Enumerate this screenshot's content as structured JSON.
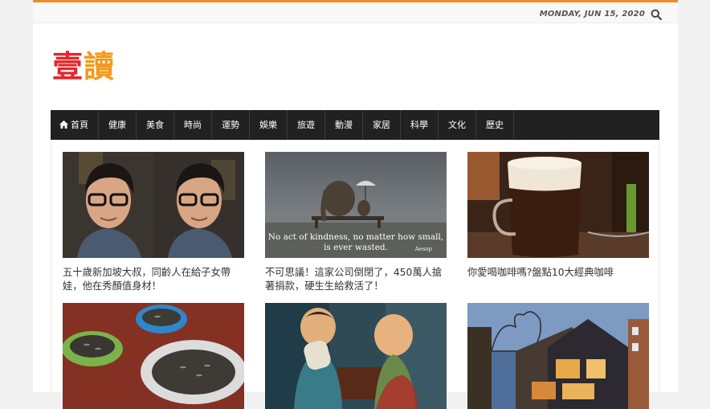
{
  "header": {
    "date": "MONDAY, JUN 15, 2020",
    "logo_char_1": "壹",
    "logo_char_2": "讀"
  },
  "nav": {
    "items": [
      "首頁",
      "健康",
      "美食",
      "時尚",
      "運勢",
      "娛樂",
      "旅遊",
      "動漫",
      "家居",
      "科學",
      "文化",
      "歷史"
    ]
  },
  "articles": [
    {
      "title": "五十歲新加坡大叔，同齡人在給子女帶娃，他在秀顏值身材！",
      "thumb": "man-with-glasses-selfie"
    },
    {
      "title": "不可思議！這家公司倒閉了，450萬人搶著捐款，硬生生給救活了！",
      "thumb": "elephant-and-dog-on-bench",
      "quote_line_1": "No act of kindness, no matter how small,",
      "quote_line_2": "is ever wasted.",
      "quote_author": "Aesop"
    },
    {
      "title": "你愛喝咖啡嗎?盤點10大經典咖啡",
      "thumb": "irish-coffee-mug"
    },
    {
      "title": "",
      "thumb": "sunflower-seeds-bowls"
    },
    {
      "title": "",
      "thumb": "ceramic-figurines"
    },
    {
      "title": "",
      "thumb": "modern-house-evening"
    }
  ],
  "colors": {
    "accent": "#f08a24",
    "nav_bg": "#212121",
    "logo_red": "#e3262a",
    "logo_orange": "#f39a1e"
  }
}
